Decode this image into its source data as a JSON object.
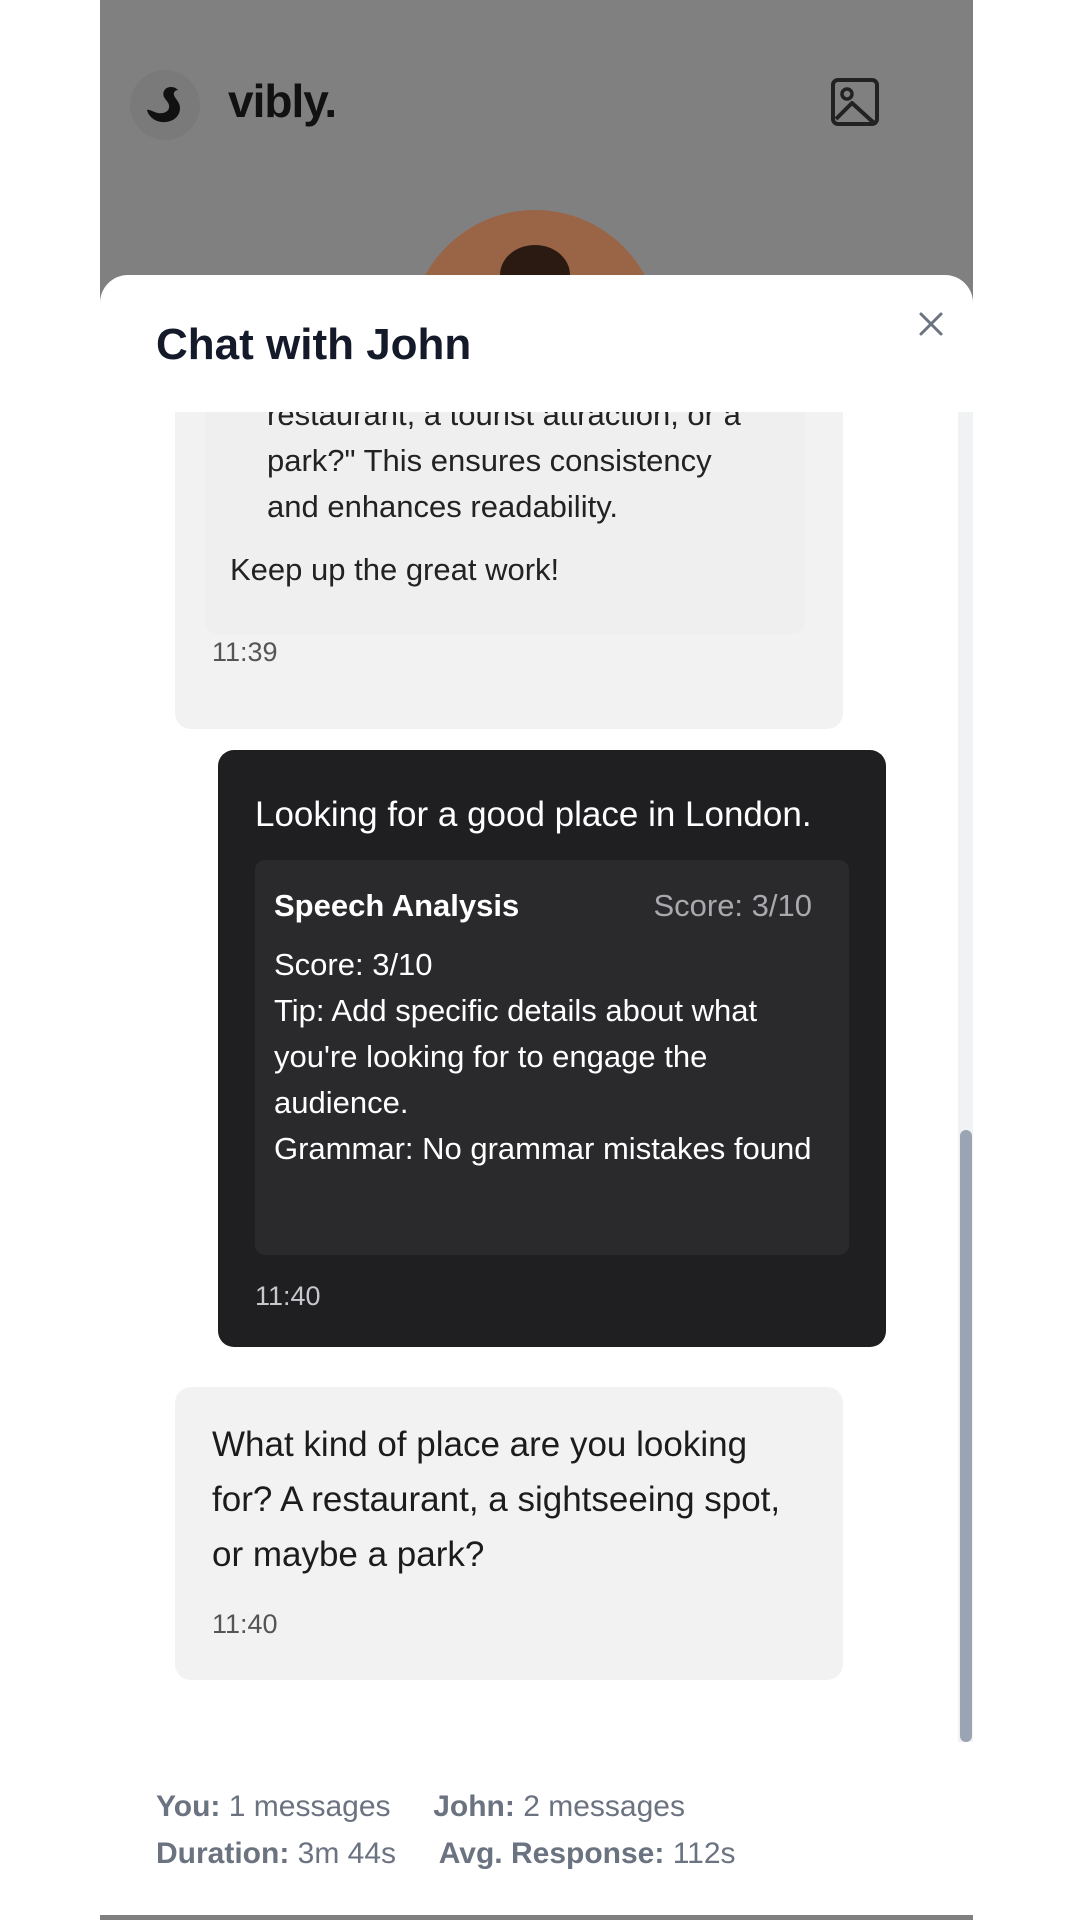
{
  "app": {
    "brand": "vibly.",
    "image_icon": "image-icon",
    "logo_icon": "swan-icon"
  },
  "modal": {
    "title": "Chat with John",
    "close_icon": "close-icon"
  },
  "messages": [
    {
      "sender": "bot",
      "continuation_lines": [
        "restaurant, a tourist attraction, or a",
        "park?\" This ensures consistency",
        "and enhances readability."
      ],
      "closing": "Keep up the great work!",
      "time": "11:39"
    },
    {
      "sender": "user",
      "text": "Looking for a good place in London.",
      "analysis": {
        "title": "Speech Analysis",
        "score_badge": "Score: 3/10",
        "score_line": "Score: 3/10",
        "tip": "Tip: Add specific details about what you're looking for to engage the audience.",
        "grammar": "Grammar: No grammar mistakes found"
      },
      "time": "11:40"
    },
    {
      "sender": "bot",
      "text": "What kind of place are you looking for? A restaurant, a sightseeing spot, or maybe a park?",
      "time": "11:40"
    }
  ],
  "stats": {
    "you_label": "You:",
    "you_value": "1 messages",
    "john_label": "John:",
    "john_value": "2 messages",
    "duration_label": "Duration:",
    "duration_value": "3m 44s",
    "avg_label": "Avg. Response:",
    "avg_value": "112s"
  }
}
